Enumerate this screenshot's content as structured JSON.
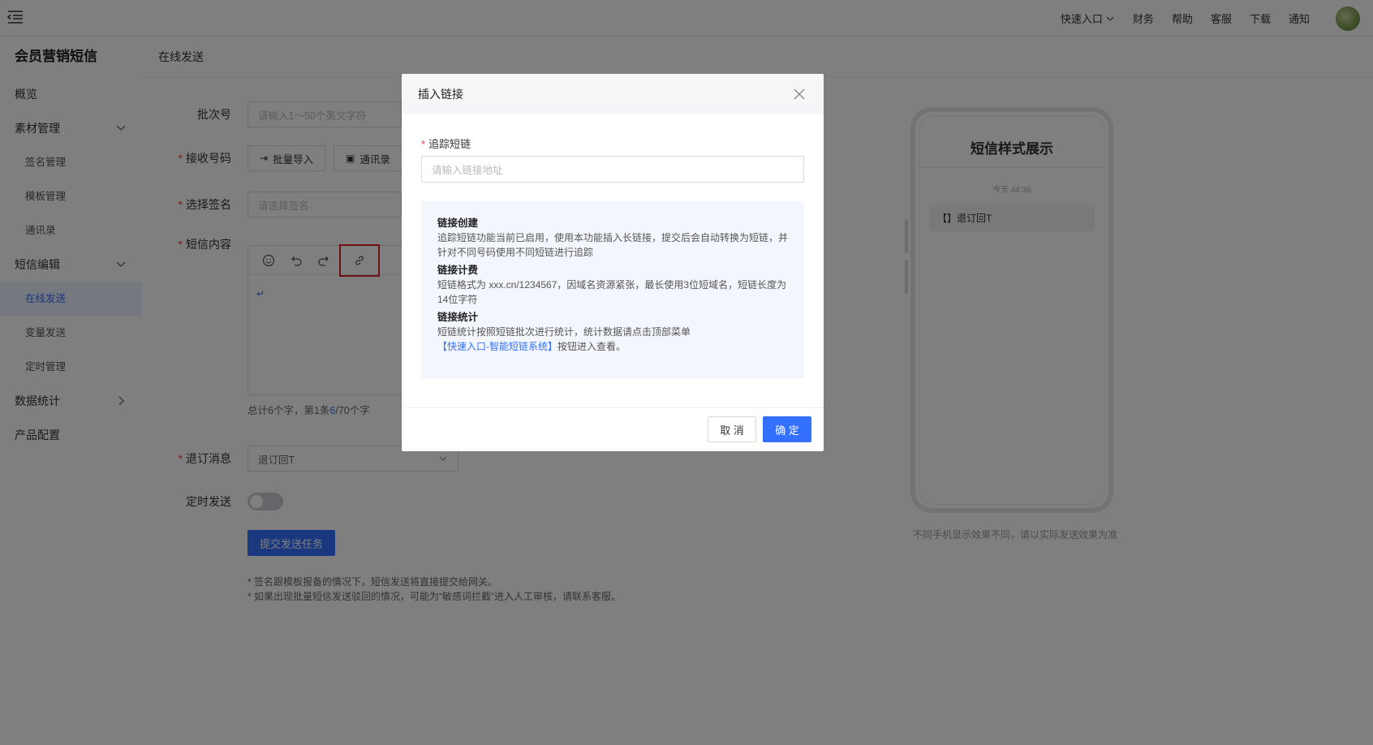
{
  "topbar": {
    "nav": [
      {
        "label": "快速入口",
        "dropdown": true
      },
      {
        "label": "财务"
      },
      {
        "label": "帮助"
      },
      {
        "label": "客服"
      },
      {
        "label": "下载"
      },
      {
        "label": "通知"
      }
    ]
  },
  "sidebar": {
    "brand": "会员营销短信",
    "items": [
      {
        "label": "概览"
      },
      {
        "label": "素材管理",
        "expanded": true
      },
      {
        "label": "签名管理"
      },
      {
        "label": "模板管理"
      },
      {
        "label": "通讯录"
      },
      {
        "label": "短信编辑",
        "expanded": true
      },
      {
        "label": "在线发送",
        "active": true
      },
      {
        "label": "变量发送"
      },
      {
        "label": "定时管理"
      },
      {
        "label": "数据统计",
        "expanded": false
      },
      {
        "label": "产品配置"
      }
    ]
  },
  "page": {
    "title": "在线发送"
  },
  "form": {
    "batch_label": "批次号",
    "batch_placeholder": "请输入1～50个英文字符",
    "receiver_label": "接收号码",
    "import_button": "批量导入",
    "contacts_button": "通讯录",
    "signature_label": "选择签名",
    "signature_placeholder": "请选择签名",
    "content_label": "短信内容",
    "content_cursor": "↵",
    "counter_prefix": "总计6个字，第1条",
    "counter_num": "6",
    "counter_suffix": "/70个字",
    "unsubscribe_label": "退订消息",
    "unsubscribe_value": "退订回T",
    "schedule_label": "定时发送",
    "schedule_on": false,
    "submit_button": "提交发送任务",
    "note1": "* 签名跟模板报备的情况下，短信发送将直接提交给网关。",
    "note2": "* 如果出现批量短信发送驳回的情况，可能为“敏感词拦截”进入人工审核，请联系客服。"
  },
  "preview": {
    "title": "短信样式展示",
    "time": "今天 44:36",
    "message": "【】退订回T",
    "note": "不同手机显示效果不同，请以实际发送效果为准"
  },
  "modal": {
    "title": "插入链接",
    "field_label": "追踪短链",
    "field_placeholder": "请输入链接地址",
    "sections": [
      {
        "title": "链接创建",
        "text": "追踪短链功能当前已启用，使用本功能插入长链接，提交后会自动转换为短链，并针对不同号码使用不同短链进行追踪"
      },
      {
        "title": "链接计费",
        "text": "短链格式为 xxx.cn/1234567，因域名资源紧张，最长使用3位短域名，短链长度为14位字符"
      },
      {
        "title": "链接统计",
        "text": "短链统计按照短链批次进行统计，统计数据请点击顶部菜单"
      }
    ],
    "stats_link": "【快速入口-智能短链系统】",
    "stats_suffix": "按钮进入查看。",
    "cancel": "取 消",
    "ok": "确 定"
  },
  "colors": {
    "primary": "#3370ff",
    "required": "#f53f3f",
    "highlight": "#e02020"
  }
}
